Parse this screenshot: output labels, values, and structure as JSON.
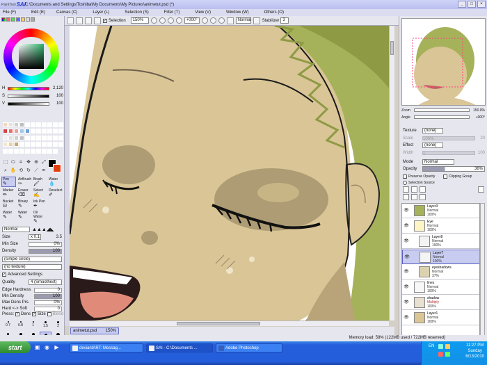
{
  "window": {
    "logo_small": "PaintTool",
    "logo_big": "SAI",
    "title": "C:\\Documents and Settings\\Toshiba\\My Documents\\My Pictures\\animetut.psd (*)",
    "minimize": "_",
    "maximize": "□",
    "close": "×"
  },
  "menu": [
    {
      "label": "File (F)"
    },
    {
      "label": "Edit (E)"
    },
    {
      "label": "Canvas (C)"
    },
    {
      "label": "Layer (L)"
    },
    {
      "label": "Selection (S)"
    },
    {
      "label": "Filter (T)"
    },
    {
      "label": "View (V)"
    },
    {
      "label": "Window (W)"
    },
    {
      "label": "Others (O)"
    }
  ],
  "color_sliders": [
    {
      "label": "H",
      "value": "2,120"
    },
    {
      "label": "S",
      "value": "100"
    },
    {
      "label": "V",
      "value": "100"
    }
  ],
  "palette": [
    "#f7d6c0",
    "#e3e3e3",
    "#cfcfcf",
    "#bbbbbb",
    "#ffffff",
    "#ffffff",
    "#ffffff",
    "#ffffff",
    "#ffffff",
    "#ffffff",
    "#ffffff",
    "#d94040",
    "#e07070",
    "#e8a0a0",
    "#a0c8e8",
    "#70a0d0",
    "#ffffff",
    "#ffffff",
    "#ffffff",
    "#ffffff",
    "#ffffff",
    "#ffffff",
    "#f0f0f0",
    "#e0e0e0",
    "#d0d0d0",
    "#c0c0c0",
    "#ffffff",
    "#ffffff",
    "#ffffff",
    "#ffffff",
    "#ffffff",
    "#ffffff",
    "#ffffff",
    "#f5e6c8",
    "#e6d2a8",
    "#c8a878",
    "#ffffff",
    "#ffffff",
    "#ffffff",
    "#ffffff",
    "#ffffff",
    "#ffffff",
    "#ffffff",
    "#ffffff",
    "#ffffff",
    "#ffffff",
    "#ffffff",
    "#ffffff",
    "#ffffff",
    "#ffffff",
    "#ffffff",
    "#ffffff",
    "#ffffff",
    "#ffffff"
  ],
  "tools": [
    "⬚",
    "⬭",
    "⌗",
    "✥",
    "⊕",
    "⤢",
    "⌕",
    "✋",
    "⟲",
    "↻",
    "⟋",
    "✒"
  ],
  "brushes": [
    {
      "label": "Pen",
      "glyph": "✎",
      "selected": true
    },
    {
      "label": "AirBrush",
      "glyph": "✑",
      "selected": false
    },
    {
      "label": "Brush",
      "glyph": "🖌",
      "selected": false
    },
    {
      "label": "Water",
      "glyph": "💧",
      "selected": false
    },
    {
      "label": "Marker",
      "glyph": "✏",
      "selected": false
    },
    {
      "label": "Eraser",
      "glyph": "⌫",
      "selected": false
    },
    {
      "label": "Select",
      "glyph": "✍",
      "selected": false
    },
    {
      "label": "Deselect",
      "glyph": "✐",
      "selected": false
    },
    {
      "label": "Bucket",
      "glyph": "⛁",
      "selected": false
    },
    {
      "label": "Binary",
      "glyph": "✎",
      "selected": false
    },
    {
      "label": "Ink Pen",
      "glyph": "✒",
      "selected": false
    },
    {
      "label": "",
      "glyph": "",
      "selected": false
    },
    {
      "label": "Water",
      "glyph": "✎",
      "selected": false
    },
    {
      "label": "Water",
      "glyph": "✎",
      "selected": false
    },
    {
      "label": "Oil Water",
      "glyph": "✎",
      "selected": false
    },
    {
      "label": "",
      "glyph": "",
      "selected": false
    }
  ],
  "brush_settings": {
    "blend_mode": "Normal",
    "size_label": "Size",
    "size_mult": "x 0.1",
    "size_value": "3.5",
    "min_size_label": "Min Size",
    "min_size_value": "0%",
    "density_label": "Density",
    "density_value": "100",
    "shape": "(simple circle)",
    "texture": "(no texture)",
    "advanced_label": "Advanced Settings",
    "quality_label": "Quality",
    "quality_value": "4 (Smoothest)",
    "edge_label": "Edge Hardness",
    "edge_value": "0",
    "min_density_label": "Min Density",
    "min_density_value": "100",
    "max_dens_label": "Max Dens Prs.",
    "max_dens_value": "0%",
    "hard_soft_label": "Hard <-> Soft",
    "hard_soft_value": "0",
    "press_label": "Press:",
    "dens_label": "Dens",
    "size2_label": "Size",
    "blend_label": "Blend"
  },
  "brush_dots": [
    {
      "label": "0.7",
      "size": 1
    },
    {
      "label": "0.8",
      "size": 1
    },
    {
      "label": "1",
      "size": 1
    },
    {
      "label": "1.5",
      "size": 2
    },
    {
      "label": "2",
      "size": 2
    },
    {
      "label": "2.3",
      "size": 2
    },
    {
      "label": "2.6",
      "size": 3
    },
    {
      "label": "3",
      "size": 3
    },
    {
      "label": "3.5",
      "size": 3,
      "selected": true
    },
    {
      "label": "4",
      "size": 4
    }
  ],
  "canvas_toolbar": {
    "selection_label": "Selection",
    "zoom": "150%",
    "angle": "+000°",
    "mode": "Normal",
    "stabilizer_label": "Stabilizer",
    "stabilizer_value": "3"
  },
  "file_tab": {
    "name": "animetut.psd",
    "zoom": "150%"
  },
  "navigator": {
    "zoom_label": "Zoom",
    "zoom_value": "150.0%",
    "angle_label": "Angle",
    "angle_value": "+000°"
  },
  "layer_props": {
    "texture_label": "Texture",
    "texture_value": "(none)",
    "scale_label": "Scale",
    "scale_value": "100%",
    "scale_num": "20",
    "effect_label": "Effect",
    "effect_value": "(none)",
    "width_label": "Width",
    "width_value": "1",
    "width_num": "100",
    "mode_label": "Mode",
    "mode_value": "Normal",
    "opacity_label": "Opacity",
    "opacity_value": "36%",
    "preserve_label": "Preserve Opacity",
    "clipping_label": "Clipping Group",
    "selsource_label": "Selection Source"
  },
  "layers": [
    {
      "name": "Layer3",
      "mode": "Normal",
      "opacity": "100%",
      "selected": false,
      "folder": false
    },
    {
      "name": "Eye",
      "mode": "Normal",
      "opacity": "100%",
      "selected": false,
      "folder": true
    },
    {
      "name": "Layer8",
      "mode": "Normal",
      "opacity": "100%",
      "selected": false,
      "folder": false
    },
    {
      "name": "Layer7",
      "mode": "Normal",
      "opacity": "100%",
      "selected": true,
      "folder": false
    },
    {
      "name": "eyeshadows",
      "mode": "Normal",
      "opacity": "37%",
      "selected": false,
      "folder": false
    },
    {
      "name": "lines",
      "mode": "Normal",
      "opacity": "100%",
      "selected": false,
      "folder": false
    },
    {
      "name": "shadow",
      "mode": "Multiply",
      "opacity": "100%",
      "selected": false,
      "folder": false
    },
    {
      "name": "Layer1",
      "mode": "Normal",
      "opacity": "100%",
      "selected": false,
      "folder": false
    }
  ],
  "status": {
    "memory": "Memory load: 58% (122MB used / 722MB reserved)"
  },
  "taskbar": {
    "start": "start",
    "tasks": [
      {
        "label": "deviantART: Messag...",
        "active": false
      },
      {
        "label": "SAI - C:\\Documents ...",
        "active": true
      },
      {
        "label": "Adobe Photoshop",
        "active": false
      }
    ],
    "lang": "EN",
    "time": "11:27 PM",
    "day": "Sunday",
    "date": "6/13/2010"
  },
  "colors": {
    "accent": "#6a72c8",
    "skin": "#d9c596",
    "hair": "#a6b25a",
    "foreground": "#000000",
    "background": "#e04010"
  }
}
